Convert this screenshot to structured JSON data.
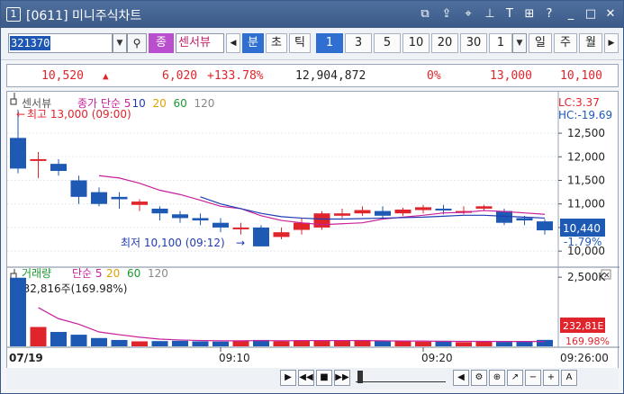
{
  "window": {
    "number": "1",
    "title": "[0611] 미니주식차트"
  },
  "toolbar": {
    "code": "321370",
    "market_badge": "종",
    "stock_name": "센서뷰",
    "buttons": [
      "분",
      "초",
      "틱"
    ],
    "periods": [
      "1",
      "3",
      "5",
      "10",
      "20",
      "30"
    ],
    "selected_period": "1",
    "interval_value": "1",
    "range_buttons": [
      "일",
      "주",
      "월"
    ]
  },
  "quote": {
    "price": "10,520",
    "change": "6,020",
    "rate": "+133.78%",
    "volume": "12,904,872",
    "diff_rate": "0%",
    "high": "13,000",
    "upper": "10,100",
    "colors": {
      "up": "#e0242c",
      "down": "#1e5ab4"
    }
  },
  "price_panel": {
    "label": "센서뷰",
    "legend": [
      {
        "text": "종가 단순 5",
        "color": "#c8209a"
      },
      {
        "text": "10",
        "color": "#1e3cb4"
      },
      {
        "text": "20",
        "color": "#e0a000"
      },
      {
        "text": "60",
        "color": "#1a9a30"
      },
      {
        "text": "120",
        "color": "#888888"
      }
    ],
    "max_note": "최고 13,000 (09:00)",
    "min_note": "최저 10,100 (09:12)",
    "lc": "LC:3.37",
    "hc": "HC:-19.69",
    "current": "10,440",
    "current_rate": "-1.79%",
    "yticks": [
      "12,500",
      "12,000",
      "11,500",
      "11,000",
      "10,500",
      "10,000"
    ]
  },
  "volume_panel": {
    "label": "거래량",
    "legend": [
      {
        "text": "단순 5",
        "color": "#c8209a"
      },
      {
        "text": "20",
        "color": "#e0a000"
      },
      {
        "text": "60",
        "color": "#1a9a30"
      },
      {
        "text": "120",
        "color": "#888888"
      }
    ],
    "note": "232,816주(169.98%)",
    "current": "232,81E",
    "current_rate": "169.98%",
    "yticks": [
      "2,500K"
    ]
  },
  "xaxis": {
    "date": "07/19",
    "ticks": [
      "09:10",
      "09:20"
    ],
    "last": "09:26:00"
  },
  "chart_data": {
    "type": "candlestick",
    "x": [
      "09:00",
      "09:01",
      "09:02",
      "09:03",
      "09:04",
      "09:05",
      "09:06",
      "09:07",
      "09:08",
      "09:09",
      "09:10",
      "09:11",
      "09:12",
      "09:13",
      "09:14",
      "09:15",
      "09:16",
      "09:17",
      "09:18",
      "09:19",
      "09:20",
      "09:21",
      "09:22",
      "09:23",
      "09:24",
      "09:25",
      "09:26"
    ],
    "open": [
      12400,
      11950,
      11850,
      11500,
      11250,
      11150,
      10980,
      10900,
      10780,
      10700,
      10600,
      10500,
      10500,
      10300,
      10450,
      10500,
      10750,
      10800,
      10850,
      10800,
      10870,
      10900,
      10830,
      10900,
      10850,
      10700,
      10630
    ],
    "close": [
      11750,
      11950,
      11700,
      11150,
      11000,
      11100,
      11050,
      10800,
      10700,
      10650,
      10500,
      10500,
      10100,
      10400,
      10600,
      10800,
      10800,
      10870,
      10750,
      10880,
      10930,
      10870,
      10850,
      10950,
      10600,
      10650,
      10440
    ],
    "high": [
      13000,
      12100,
      11950,
      11600,
      11350,
      11250,
      11100,
      10950,
      10850,
      10800,
      10700,
      10600,
      10550,
      10500,
      10700,
      10850,
      10900,
      10950,
      10950,
      10920,
      10980,
      10980,
      10950,
      10980,
      10900,
      10750,
      10680
    ],
    "low": [
      11650,
      11550,
      11600,
      11000,
      10950,
      10900,
      10850,
      10650,
      10600,
      10550,
      10400,
      10350,
      10100,
      10250,
      10350,
      10450,
      10700,
      10750,
      10700,
      10750,
      10800,
      10780,
      10780,
      10850,
      10550,
      10550,
      10350
    ],
    "ma": [
      [],
      [],
      [],
      [],
      [
        11600,
        11550,
        11440,
        11290,
        11200,
        11080,
        10950,
        10900,
        10750,
        10650,
        10600,
        10560,
        10580,
        10600,
        10680,
        10720,
        10760,
        10810,
        10820,
        10860,
        10840,
        10810,
        10780
      ],
      [],
      [],
      [],
      [],
      [
        11150,
        11000,
        10900,
        10800,
        10730,
        10700,
        10680,
        10680,
        10690,
        10700,
        10710,
        10720,
        10740,
        10760,
        10760,
        10740,
        10720,
        10700
      ]
    ],
    "volume": [
      2480000,
      700000,
      520000,
      420000,
      300000,
      230000,
      180000,
      190000,
      200000,
      180000,
      170000,
      210000,
      230000,
      180000,
      220000,
      210000,
      200000,
      230000,
      200000,
      180000,
      170000,
      200000,
      150000,
      170000,
      160000,
      190000,
      232816
    ],
    "volume_ma": [
      1400000,
      1000000,
      800000,
      520000,
      420000,
      330000,
      260000,
      230000,
      210000,
      200000,
      200000,
      210000,
      200000,
      210000,
      210000,
      210000,
      210000,
      200000,
      190000,
      190000,
      180000,
      180000,
      180000,
      175000,
      175000,
      175000
    ]
  }
}
